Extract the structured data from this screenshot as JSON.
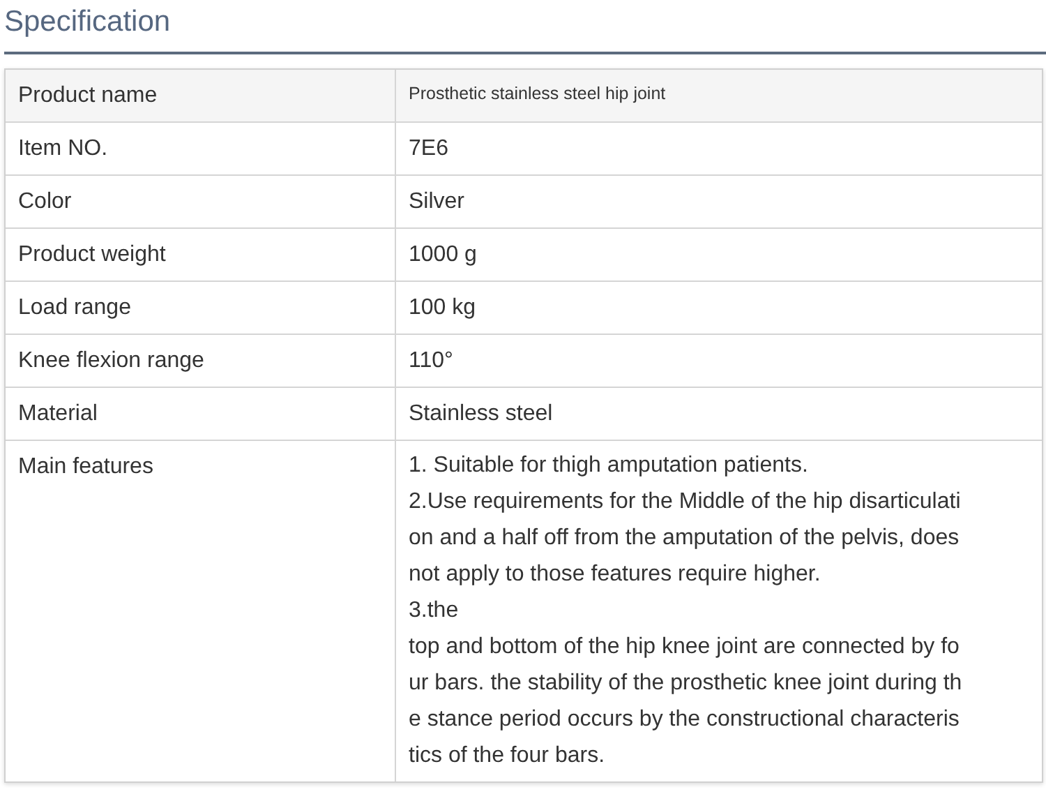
{
  "title": "Specification",
  "rows": [
    {
      "label": "Product name",
      "kind": "small",
      "value": "Prosthetic stainless steel hip joint"
    },
    {
      "label": "Item NO.",
      "kind": "text",
      "value": "7E6"
    },
    {
      "label": "Color",
      "kind": "text",
      "value": "Silver"
    },
    {
      "label": "Product weight",
      "kind": "text",
      "value": "1000 g"
    },
    {
      "label": "Load range",
      "kind": "text",
      "value": "100 kg"
    },
    {
      "label": "Knee flexion range",
      "kind": "text",
      "value": "110°"
    },
    {
      "label": "Material",
      "kind": "text",
      "value": "Stainless steel"
    },
    {
      "label": "Main features",
      "kind": "lines",
      "lines": [
        "1. Suitable for thigh amputation patients.",
        "2.Use requirements for the Middle of the hip disarticulati",
        "on and a half off from the amputation of the pelvis, does",
        "not apply to those features require higher.",
        "3.the",
        "top and bottom of the hip knee joint are connected by fo",
        "ur bars. the stability of the prosthetic knee joint during th",
        "e stance period occurs by the constructional characteris",
        "tics of the four bars."
      ]
    }
  ]
}
